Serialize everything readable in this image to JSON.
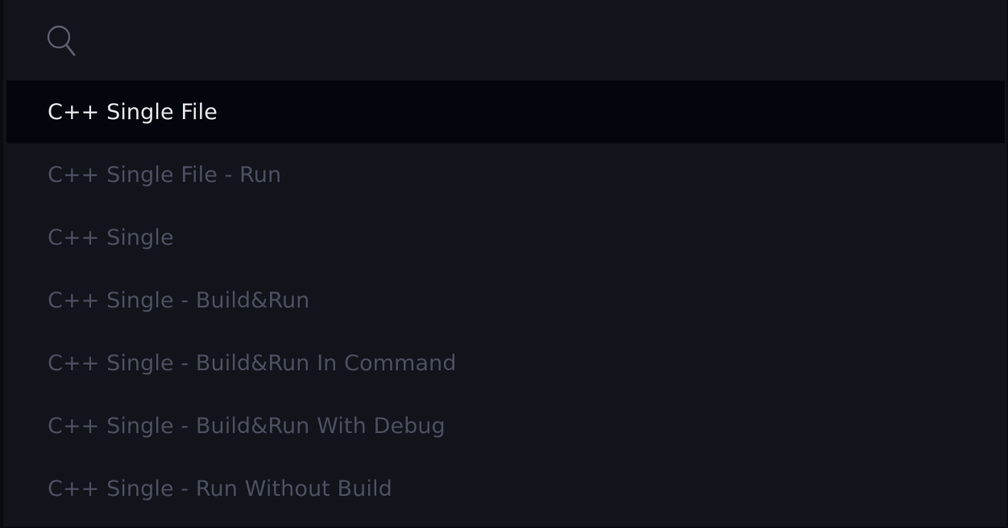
{
  "search": {
    "value": "",
    "placeholder": ""
  },
  "items": [
    {
      "label": "C++ Single File",
      "selected": true
    },
    {
      "label": "C++ Single File - Run",
      "selected": false
    },
    {
      "label": "C++ Single",
      "selected": false
    },
    {
      "label": "C++ Single - Build&Run",
      "selected": false
    },
    {
      "label": "C++ Single - Build&Run In Command",
      "selected": false
    },
    {
      "label": "C++ Single - Build&Run With Debug",
      "selected": false
    },
    {
      "label": "C++ Single - Run Without Build",
      "selected": false
    }
  ],
  "colors": {
    "background": "#11141b",
    "selected_background": "#04060d",
    "selected_text": "#e4e6ea",
    "dim_text": "#4b5060"
  }
}
